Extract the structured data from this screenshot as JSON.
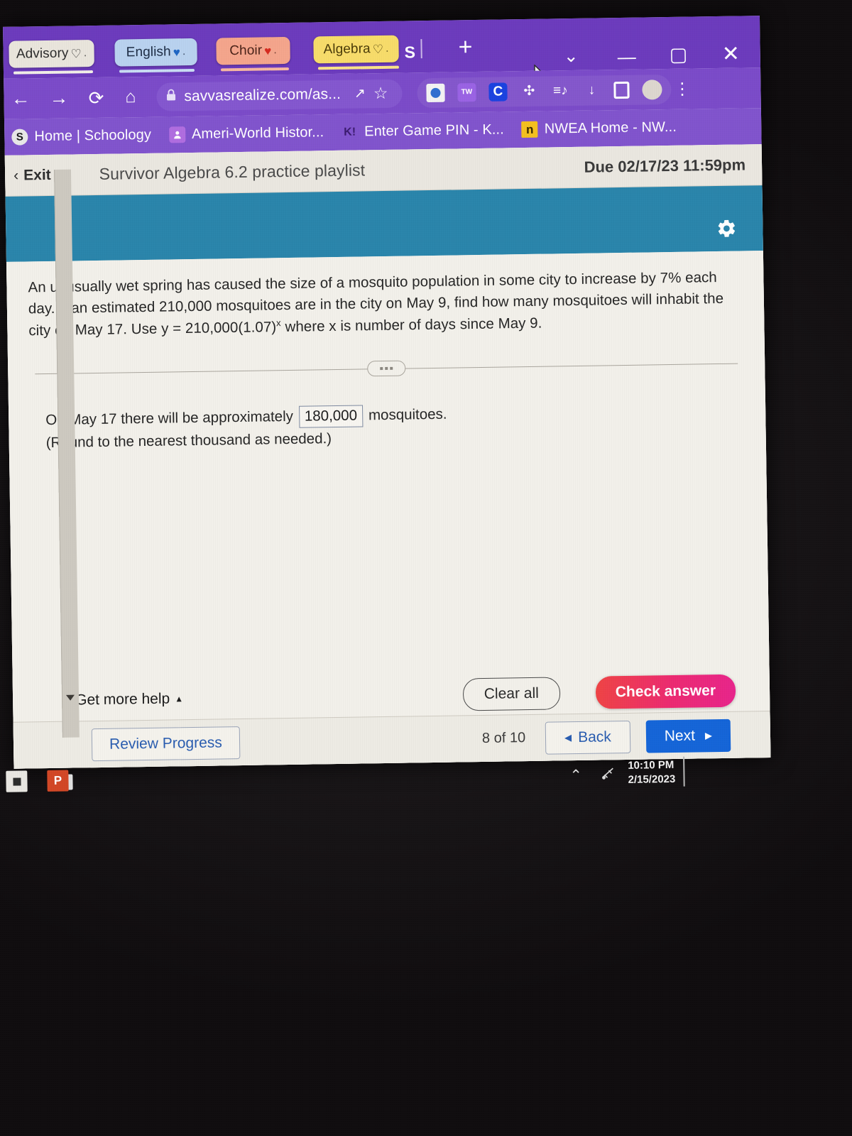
{
  "browser": {
    "tabs": [
      {
        "label": "Advisory",
        "heart": "♡",
        "trailing": ".",
        "icon": "heart-outline-icon"
      },
      {
        "label": "English",
        "heart": "♥",
        "trailing": ".",
        "icon": "heart-blue-icon"
      },
      {
        "label": "Choir",
        "heart": "♥",
        "trailing": ".",
        "icon": "heart-red-icon"
      },
      {
        "label": "Algebra",
        "heart": "♡",
        "trailing": ".",
        "icon": "heart-outline-icon"
      }
    ],
    "tab_overflow_label": "S",
    "new_tab_label": "+",
    "window_controls": {
      "chevron": "⌄",
      "minimize": "—",
      "maximize": "▢",
      "close": "✕"
    },
    "nav": {
      "back": "←",
      "forward": "→",
      "reload": "⟳",
      "home": "⌂"
    },
    "omnibox": {
      "lock": "🔒",
      "url": "savvasrealize.com/as...",
      "share": "↗",
      "star": "☆"
    },
    "extensions": [
      {
        "name": "globe-extension-icon",
        "label": ""
      },
      {
        "name": "tw-extension-icon",
        "label": "TW"
      },
      {
        "name": "c-extension-icon",
        "label": "C"
      },
      {
        "name": "puzzle-extension-icon",
        "label": "✣"
      },
      {
        "name": "playlist-extension-icon",
        "label": "≡♪"
      },
      {
        "name": "download-icon",
        "label": "↓"
      },
      {
        "name": "square-extension-icon",
        "label": ""
      },
      {
        "name": "profile-avatar",
        "label": ""
      }
    ],
    "menu_label": "⋮",
    "bookmarks": [
      {
        "label": "Home | Schoology",
        "favicon": "S"
      },
      {
        "label": "Ameri-World Histor...",
        "favicon": "👤"
      },
      {
        "label": "Enter Game PIN - K...",
        "favicon": "K!"
      },
      {
        "label": "NWEA Home - NW...",
        "favicon": "n"
      }
    ]
  },
  "app": {
    "exit_label": "Exit",
    "exit_chevron": "‹",
    "assignment_title": "Survivor Algebra 6.2 practice playlist",
    "due_label": "Due 02/17/23 11:59pm",
    "settings_icon": "gear-icon",
    "banner_color": "#2a85ab"
  },
  "question": {
    "prompt_part1": "An unusually wet spring has caused the size of a mosquito population in some city to increase by 7% each day. If an estimated 210,000 mosquitoes are in the city on May 9, find how many mosquitoes will inhabit the city on May 17. Use y = 210,000(1.07)",
    "prompt_exponent": "x",
    "prompt_part2": " where x is number of days since May 9.",
    "divider_expander": "...",
    "answer_prefix": "On May 17 there will be approximately",
    "answer_value": "180,000",
    "answer_suffix": "mosquitoes.",
    "answer_note": "(Round to the nearest thousand as needed.)"
  },
  "actions": {
    "get_more_help_label": "Get more help",
    "get_more_help_caret": "▲",
    "clear_all_label": "Clear all",
    "check_answer_label": "Check answer",
    "check_answer_color": "#ec2a72"
  },
  "footer": {
    "review_progress_label": "Review Progress",
    "question_count": "8 of 10",
    "back_label": "Back",
    "back_arrow": "◀",
    "next_label": "Next",
    "next_arrow": "▶",
    "next_color": "#1565d8"
  },
  "taskbar": {
    "explorer_icon": "file-explorer-icon",
    "powerpoint_icon": "powerpoint-icon",
    "powerpoint_label": "P",
    "tray_chevron": "⌃",
    "tray_network": "🖧",
    "clock_time": "10:10 PM",
    "clock_date": "2/15/2023"
  }
}
